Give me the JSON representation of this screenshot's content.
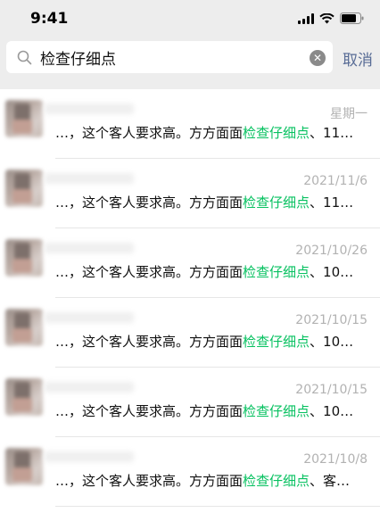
{
  "status_bar": {
    "time": "9:41"
  },
  "search": {
    "value": "检查仔细点",
    "cancel_label": "取消"
  },
  "results": [
    {
      "date": "星期一",
      "prefix": "…，这个客人要求高。方方面面",
      "keyword": "检查仔细点",
      "suffix": "、11…"
    },
    {
      "date": "2021/11/6",
      "prefix": "…，这个客人要求高。方方面面",
      "keyword": "检查仔细点",
      "suffix": "、11…"
    },
    {
      "date": "2021/10/26",
      "prefix": "…，这个客人要求高。方方面面",
      "keyword": "检查仔细点",
      "suffix": "、10…"
    },
    {
      "date": "2021/10/15",
      "prefix": "…，这个客人要求高。方方面面",
      "keyword": "检查仔细点",
      "suffix": "、10…"
    },
    {
      "date": "2021/10/15",
      "prefix": "…，这个客人要求高。方方面面",
      "keyword": "检查仔细点",
      "suffix": "、10…"
    },
    {
      "date": "2021/10/8",
      "prefix": "…，这个客人要求高。方方面面",
      "keyword": "检查仔细点",
      "suffix": "、客…"
    }
  ],
  "colors": {
    "highlight": "#07c160",
    "cancel": "#576b95",
    "background": "#ededed"
  },
  "icons": {
    "search": "search-icon",
    "clear": "clear-icon",
    "signal": "signal-icon",
    "wifi": "wifi-icon",
    "battery": "battery-icon"
  }
}
